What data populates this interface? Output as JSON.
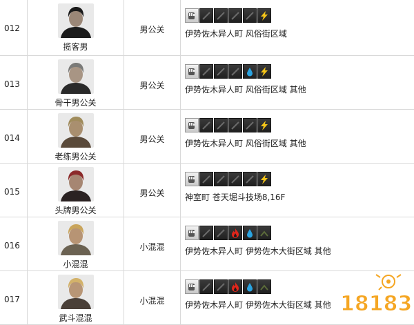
{
  "rows": [
    {
      "num": "012",
      "name": "揽客男",
      "type": "男公关",
      "icons": [
        "fist",
        "dim",
        "dim",
        "dim",
        "dim",
        "bolt"
      ],
      "location": "伊势佐木异人町 风俗街区域",
      "portrait": {
        "skin": "#9b8777",
        "hair": "#1b1b1b",
        "cloth": "#1c1c1c"
      }
    },
    {
      "num": "013",
      "name": "骨干男公关",
      "type": "男公关",
      "icons": [
        "fist",
        "dim",
        "dim",
        "dim",
        "drop",
        "bolt"
      ],
      "location": "伊势佐木异人町 风俗街区域 其他",
      "portrait": {
        "skin": "#a89584",
        "hair": "#7a7a78",
        "cloth": "#2a2a2a"
      }
    },
    {
      "num": "014",
      "name": "老练男公关",
      "type": "男公关",
      "icons": [
        "fist",
        "dim",
        "dim",
        "dim",
        "dim",
        "bolt"
      ],
      "location": "伊势佐木异人町 风俗街区域 其他",
      "portrait": {
        "skin": "#a98f6f",
        "hair": "#a08c5c",
        "cloth": "#5a4a3a"
      }
    },
    {
      "num": "015",
      "name": "头牌男公关",
      "type": "男公关",
      "icons": [
        "fist",
        "dim",
        "dim",
        "dim",
        "dim",
        "bolt"
      ],
      "location": "神室町 苍天堀斗技场8,16F",
      "portrait": {
        "skin": "#a68672",
        "hair": "#8c2a2a",
        "cloth": "#2a2222"
      }
    },
    {
      "num": "016",
      "name": "小混混",
      "type": "小混混",
      "icons": [
        "fist",
        "dim",
        "dim",
        "fire",
        "drop",
        "dimg"
      ],
      "location": "伊势佐木异人町 伊势佐木大街区域 其他",
      "portrait": {
        "skin": "#b79474",
        "hair": "#c9a55c",
        "cloth": "#6b6252"
      }
    },
    {
      "num": "017",
      "name": "武斗混混",
      "type": "小混混",
      "icons": [
        "fist",
        "dim",
        "dim",
        "fire",
        "drop",
        "dimg"
      ],
      "location": "伊势佐木异人町 伊势佐木大街区域 其他",
      "portrait": {
        "skin": "#b89676",
        "hair": "#d3b26a",
        "cloth": "#4a4038"
      }
    }
  ],
  "logo": {
    "text": "18183",
    "color": "#f5a623"
  },
  "colors": {
    "bolt": "#f5c518",
    "drop": "#2aa3e0",
    "fire": "#e0261b"
  }
}
